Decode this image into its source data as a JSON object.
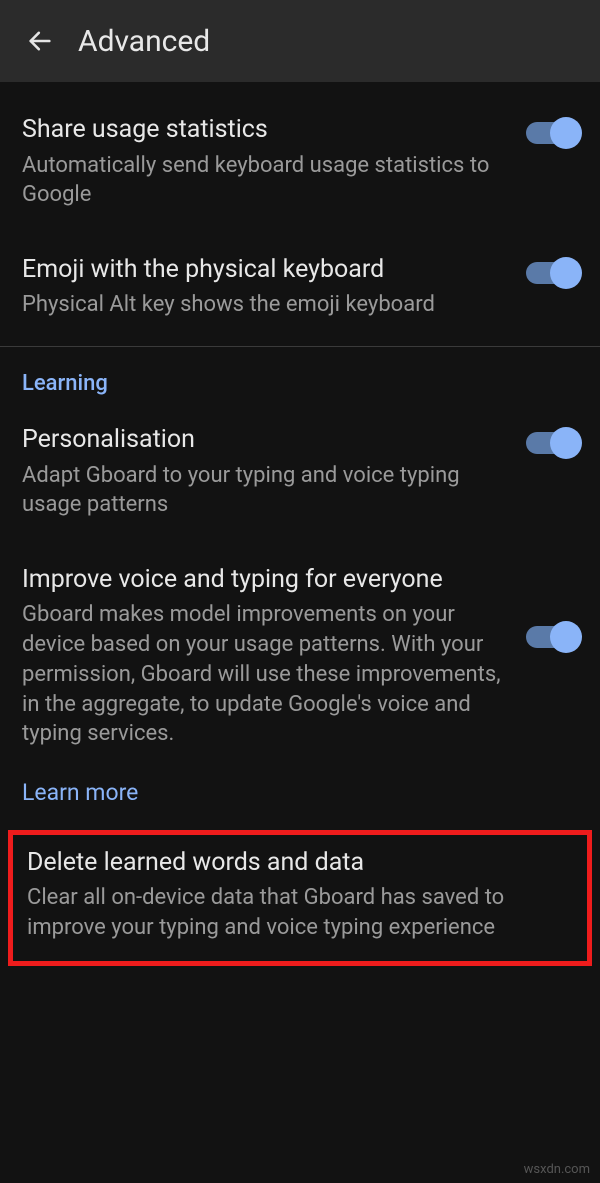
{
  "header": {
    "title": "Advanced"
  },
  "items": {
    "share_stats": {
      "title": "Share usage statistics",
      "sub": "Automatically send keyboard usage statistics to Google"
    },
    "emoji_physical": {
      "title": "Emoji with the physical keyboard",
      "sub": "Physical Alt key shows the emoji keyboard"
    },
    "section_learning": "Learning",
    "personalisation": {
      "title": "Personalisation",
      "sub": "Adapt Gboard to your typing and voice typing usage patterns"
    },
    "improve": {
      "title": "Improve voice and typing for everyone",
      "sub": "Gboard makes model improvements on your device based on your usage patterns. With your permission, Gboard will use these improvements, in the aggregate, to update Google's voice and typing services."
    },
    "learn_more": "Learn more",
    "delete": {
      "title": "Delete learned words and data",
      "sub": "Clear all on-device data that Gboard has saved to improve your typing and voice typing experience"
    }
  },
  "watermark": "wsxdn.com"
}
